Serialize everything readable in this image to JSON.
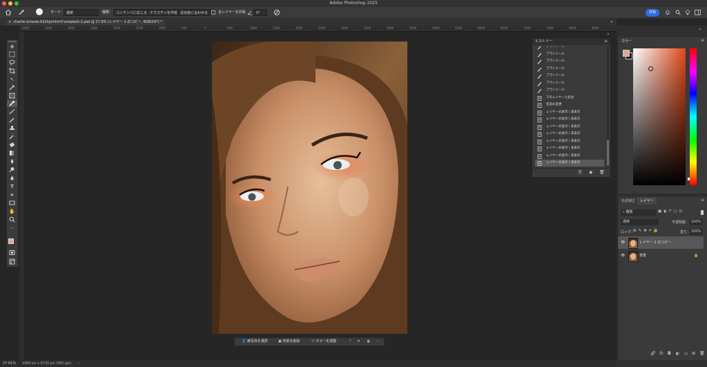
{
  "window": {
    "title": "Adobe Photoshop 2025"
  },
  "options_bar": {
    "mode_label": "モード：",
    "mode_value": "通常",
    "type_label": "種類：",
    "btn_content_aware": "コンテンツに応じる",
    "btn_create_texture": "テクスチャを作成",
    "btn_proximity_match": "近似色に合わせる",
    "sample_all_layers": "全レイヤーを対象",
    "angle_value": "0°",
    "share_label": "共有"
  },
  "document": {
    "tab_title": "charlie-octavia-01kXpvhhrnY-unsplash-2.psd @ 27.6% (レイヤー 1 のコピー, RGB/16*) *"
  },
  "ruler": {
    "ticks": [
      "4000",
      "3500",
      "3000",
      "2500",
      "2000",
      "1500",
      "1000",
      "500",
      "0",
      "500",
      "1000",
      "1500",
      "2000",
      "2500",
      "3000",
      "3500",
      "4000",
      "4500",
      "5000",
      "5500",
      "6000",
      "6500",
      "7000",
      "7500",
      "8000",
      "8500"
    ]
  },
  "context_bar": {
    "select_subject": "被写体を選択",
    "remove_background": "背景を削除",
    "adjust_color": "カラーを調整"
  },
  "status_bar": {
    "zoom": "27.61%",
    "doc_info": "4480 px x 6720 px (300 ppi)"
  },
  "history": {
    "title": "ヒストリー",
    "items": [
      {
        "label": "ブラシツール",
        "icon": "brush-icon"
      },
      {
        "label": "ブラシツール",
        "icon": "brush-icon"
      },
      {
        "label": "ブラシツール",
        "icon": "brush-icon"
      },
      {
        "label": "ブラシツール",
        "icon": "brush-icon"
      },
      {
        "label": "ブラシツール",
        "icon": "brush-icon"
      },
      {
        "label": "ブラシツール",
        "icon": "brush-icon"
      },
      {
        "label": "ブラシツール",
        "icon": "brush-icon"
      },
      {
        "label": "下のレイヤーと結合",
        "icon": "history-state-icon"
      },
      {
        "label": "名前の変更",
        "icon": "history-state-icon"
      },
      {
        "label": "レイヤーの表示 / 非表示",
        "icon": "history-state-icon"
      },
      {
        "label": "レイヤーの表示 / 非表示",
        "icon": "history-state-icon"
      },
      {
        "label": "レイヤーの表示 / 非表示",
        "icon": "history-state-icon"
      },
      {
        "label": "レイヤーの表示 / 非表示",
        "icon": "history-state-icon"
      },
      {
        "label": "レイヤーの表示 / 非表示",
        "icon": "history-state-icon"
      },
      {
        "label": "レイヤーの表示 / 非表示",
        "icon": "history-state-icon"
      },
      {
        "label": "レイヤーの表示 / 非表示",
        "icon": "history-state-icon"
      },
      {
        "label": "レイヤーの表示 / 非表示",
        "icon": "history-state-icon"
      }
    ]
  },
  "color_panel": {
    "title": "カラー",
    "foreground": "#e0a890",
    "background": "#1a1a1a",
    "hue_color": "#e04818"
  },
  "layers_panel": {
    "tab_adjustments": "色調補正",
    "tab_layers": "レイヤー",
    "filter_kind": "種類",
    "blend_mode": "通常",
    "opacity_label": "不透明度：",
    "opacity_value": "100%",
    "lock_label": "ロック：",
    "fill_label": "塗り：",
    "fill_value": "100%",
    "layers": [
      {
        "name": "レイヤー 1 のコピー",
        "selected": true,
        "locked": false
      },
      {
        "name": "背景",
        "selected": false,
        "locked": true
      }
    ]
  },
  "colors": {
    "accent": "#2b6de0",
    "selection": "#5a5a5a"
  }
}
